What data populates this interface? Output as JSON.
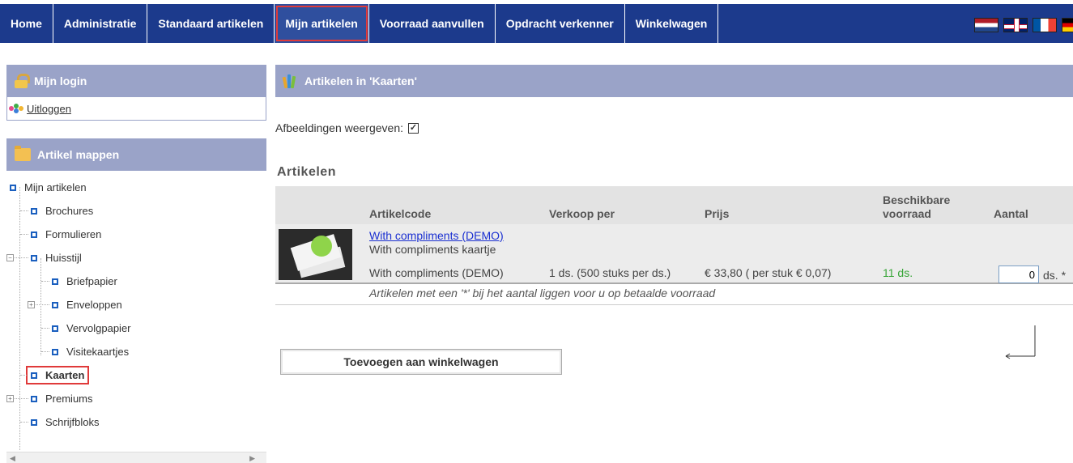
{
  "nav": {
    "items": [
      {
        "label": "Home",
        "active": false
      },
      {
        "label": "Administratie",
        "active": false
      },
      {
        "label": "Standaard artikelen",
        "active": false
      },
      {
        "label": "Mijn artikelen",
        "active": true
      },
      {
        "label": "Voorraad aanvullen",
        "active": false
      },
      {
        "label": "Opdracht verkenner",
        "active": false
      },
      {
        "label": "Winkelwagen",
        "active": false
      }
    ],
    "flags": [
      "flag-nl-icon",
      "flag-uk-icon",
      "flag-fr-icon",
      "flag-de-icon"
    ]
  },
  "login": {
    "title": "Mijn login",
    "logout": "Uitloggen"
  },
  "folders": {
    "title": "Artikel mappen",
    "tree": [
      {
        "label": "Mijn artikelen"
      },
      {
        "label": "Brochures"
      },
      {
        "label": "Formulieren"
      },
      {
        "label": "Huisstijl"
      },
      {
        "label": "Briefpapier"
      },
      {
        "label": "Enveloppen"
      },
      {
        "label": "Vervolgpapier"
      },
      {
        "label": "Visitekaartjes"
      },
      {
        "label": "Kaarten"
      },
      {
        "label": "Premiums"
      },
      {
        "label": "Schrijfbloks"
      }
    ]
  },
  "main": {
    "title": "Artikelen in 'Kaarten'",
    "show_images_label": "Afbeeldingen weergeven:",
    "show_images_checked": true,
    "section_title": "Artikelen",
    "columns": {
      "code": "Artikelcode",
      "sold_per": "Verkoop per",
      "price": "Prijs",
      "stock_line1": "Beschikbare",
      "stock_line2": "voorraad",
      "qty": "Aantal"
    },
    "rows": [
      {
        "link": "With compliments (DEMO)",
        "description": "With compliments kaartje",
        "code": "With compliments (DEMO)",
        "sold_per": "1 ds. (500 stuks per ds.)",
        "price": "€ 33,80 ( per stuk € 0,07)",
        "stock": "11 ds.",
        "qty": "0",
        "unit": "ds. *"
      }
    ],
    "note": "Artikelen met een '*' bij het aantal liggen voor u op betaalde voorraad",
    "add_button": "Toevoegen aan winkelwagen",
    "colors": {
      "nav_bg": "#1c3a8c",
      "header_bg": "#9aa3c8",
      "stock_green": "#38a538",
      "link_blue": "#1a2fd1"
    }
  }
}
